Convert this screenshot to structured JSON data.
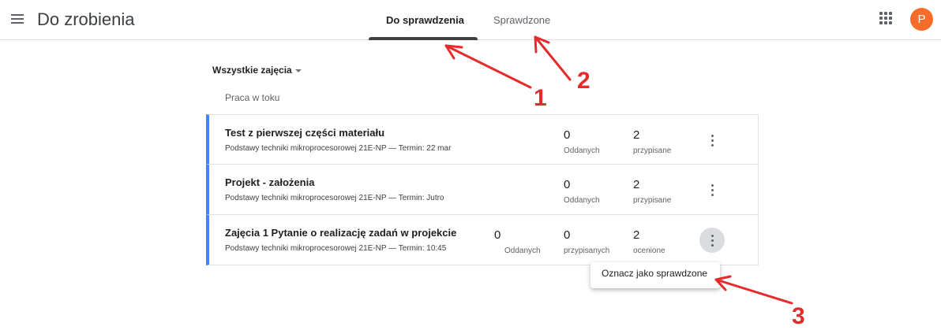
{
  "header": {
    "title": "Do zrobienia",
    "tabs": [
      {
        "label": "Do sprawdzenia",
        "active": true
      },
      {
        "label": "Sprawdzone",
        "active": false
      }
    ],
    "avatar_letter": "P",
    "avatar_color": "#f66d2b"
  },
  "filter": {
    "label": "Wszystkie zajęcia"
  },
  "section": {
    "label": "Praca w toku"
  },
  "accent_color": "#4285f4",
  "assignments": [
    {
      "title": "Test z pierwszej części materiału",
      "subtitle": "Podstawy techniki mikroprocesorowej 21E-NP — Termin: 22 mar",
      "stats": [
        {
          "value": "0",
          "label": "Oddanych"
        },
        {
          "value": "2",
          "label": "przypisane"
        }
      ]
    },
    {
      "title": "Projekt - założenia",
      "subtitle": "Podstawy techniki mikroprocesorowej 21E-NP — Termin: Jutro",
      "stats": [
        {
          "value": "0",
          "label": "Oddanych"
        },
        {
          "value": "2",
          "label": "przypisane"
        }
      ]
    },
    {
      "title": "Zajęcia 1 Pytanie o realizację zadań w projekcie",
      "subtitle": "Podstawy techniki mikroprocesorowej 21E-NP — Termin: 10:45",
      "stats": [
        {
          "value": "0",
          "label": "Oddanych"
        },
        {
          "value": "0",
          "label": "przypisanych"
        },
        {
          "value": "2",
          "label": "ocenione"
        }
      ]
    }
  ],
  "context_menu": {
    "item": "Oznacz jako sprawdzone"
  },
  "annotations": {
    "color": "#e52b2b",
    "labels": [
      "1",
      "2",
      "3"
    ]
  }
}
